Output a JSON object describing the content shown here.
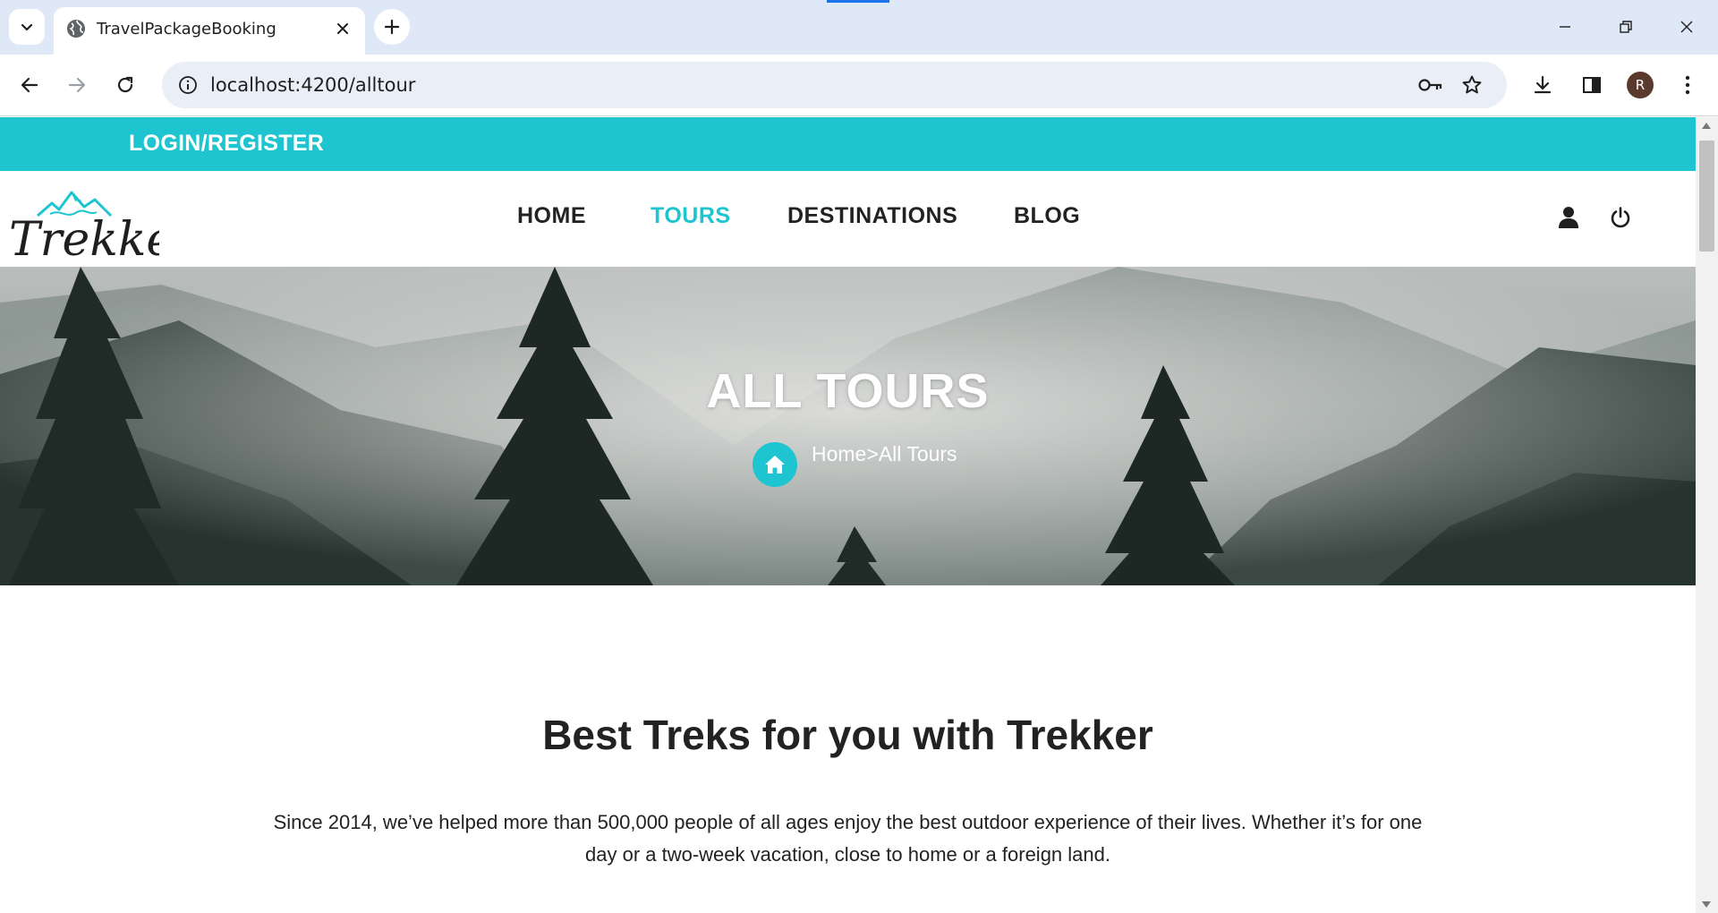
{
  "browser": {
    "tab_title": "TravelPackageBooking",
    "url": "localhost:4200/alltour",
    "avatar_letter": "R",
    "accent_color": "#1a73e8",
    "tabbar_color": "#dfe8f7"
  },
  "site": {
    "brand_color": "#1ec5d0",
    "topbar": {
      "login_label": "LOGIN/REGISTER"
    },
    "logo": {
      "text": "Trekker"
    },
    "nav": {
      "home": "HOME",
      "tours": "TOURS",
      "destinations": "DESTINATIONS",
      "blog": "BLOG",
      "active": "TOURS"
    },
    "hero": {
      "title": "ALL TOURS",
      "breadcrumb": "Home>All Tours"
    },
    "intro": {
      "title": "Best Treks for you with Trekker",
      "text": "Since 2014, we’ve helped more than 500,000 people of all ages enjoy the best outdoor experience of their lives. Whether it’s for one day or a two-week vacation, close to home or a foreign land."
    }
  }
}
